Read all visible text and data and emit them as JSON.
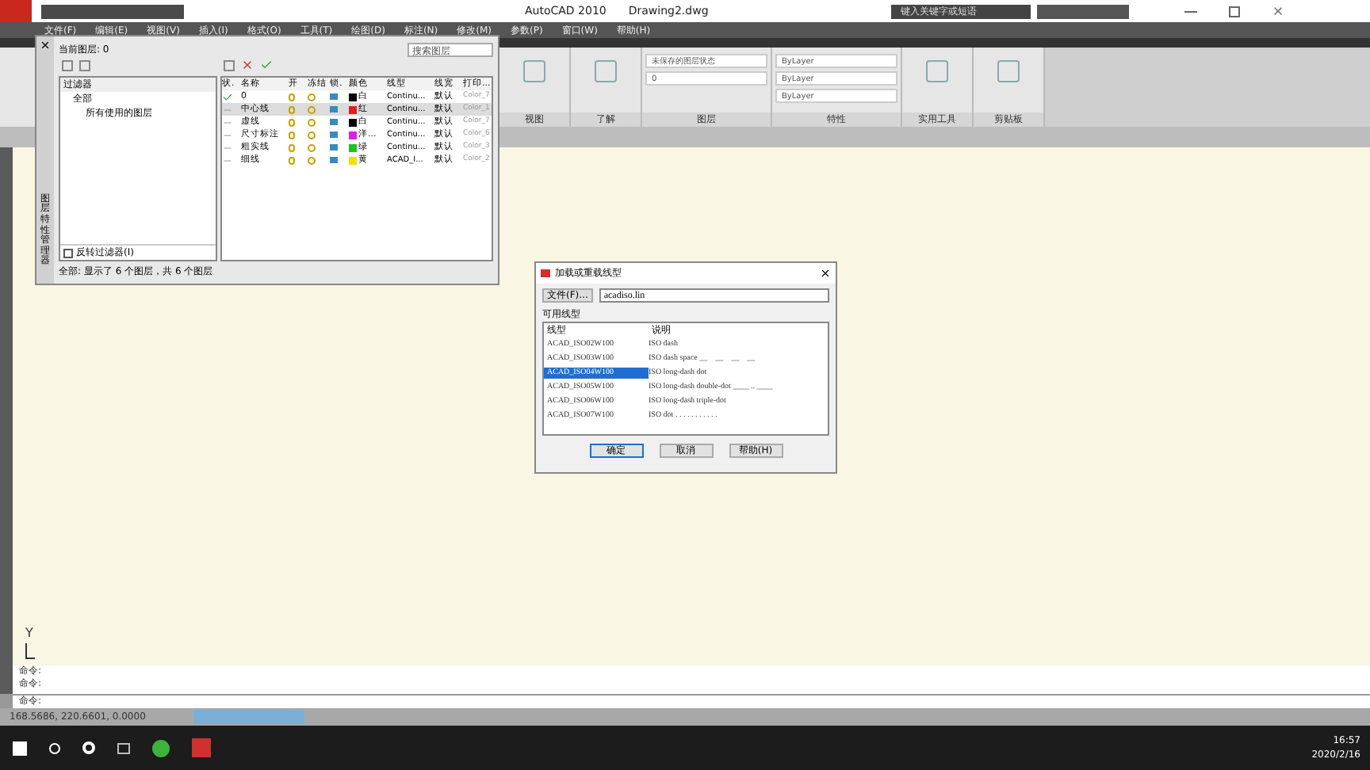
{
  "window": {
    "title": "AutoCAD 2010",
    "document": "Drawing2.dwg"
  },
  "search": {
    "placeholder": "键入关键字或短语"
  },
  "menu": [
    "文件(F)",
    "编辑(E)",
    "视图(V)",
    "插入(I)",
    "格式(O)",
    "工具(T)",
    "绘图(D)",
    "标注(N)",
    "修改(M)",
    "参数(P)",
    "窗口(W)",
    "帮助(H)"
  ],
  "ribbon": {
    "panels": [
      {
        "title": "视图"
      },
      {
        "title": "了解"
      },
      {
        "title": "图层",
        "dropdowns": [
          "未保存的图层状态",
          "0"
        ]
      },
      {
        "title": "特性",
        "dropdowns": [
          "ByLayer",
          "ByLayer",
          "ByLayer"
        ]
      },
      {
        "title": "实用工具"
      },
      {
        "title": "剪贴板"
      }
    ]
  },
  "layer_manager": {
    "current_layer": "当前图层: 0",
    "search": {
      "placeholder": "搜索图层"
    },
    "filters": {
      "title": "过滤器",
      "tree": [
        {
          "label": "全部",
          "children": [
            {
              "label": "所有使用的图层"
            }
          ]
        }
      ],
      "invert": {
        "label": "反转过滤器(I)",
        "checked": false
      }
    },
    "columns": [
      "状.",
      "名称",
      "开",
      "冻结",
      "锁.",
      "颜色",
      "线型",
      "线宽",
      "打印..."
    ],
    "layers": [
      {
        "current": true,
        "selected": false,
        "name": "0",
        "color": "#000000",
        "color_name": "白",
        "linetype": "Continu...",
        "lineweight": "默认",
        "plot_style": "Color_7"
      },
      {
        "current": false,
        "selected": true,
        "name": "中心线",
        "color": "#e02020",
        "color_name": "红",
        "linetype": "Continu...",
        "lineweight": "默认",
        "plot_style": "Color_1"
      },
      {
        "current": false,
        "selected": false,
        "name": "虚线",
        "color": "#000000",
        "color_name": "白",
        "linetype": "Continu...",
        "lineweight": "默认",
        "plot_style": "Color_7"
      },
      {
        "current": false,
        "selected": false,
        "name": "尺寸标注",
        "color": "#e020e0",
        "color_name": "洋...",
        "linetype": "Continu...",
        "lineweight": "默认",
        "plot_style": "Color_6"
      },
      {
        "current": false,
        "selected": false,
        "name": "粗实线",
        "color": "#20c020",
        "color_name": "绿",
        "linetype": "Continu...",
        "lineweight": "默认",
        "plot_style": "Color_3"
      },
      {
        "current": false,
        "selected": false,
        "name": "细线",
        "color": "#f0e000",
        "color_name": "黄",
        "linetype": "ACAD_I...",
        "lineweight": "默认",
        "plot_style": "Color_2"
      }
    ],
    "status": "全部: 显示了 6 个图层，共 6 个图层",
    "side_label": "图层特性管理器"
  },
  "dialog": {
    "title": "加载或重载线型",
    "file_button": "文件(F)...",
    "file": "acadiso.lin",
    "list_label": "可用线型",
    "columns": [
      "线型",
      "说明"
    ],
    "rows": [
      {
        "name": "ACAD_ISO02W100",
        "description": "ISO dash",
        "selected": false
      },
      {
        "name": "ACAD_ISO03W100",
        "description": "ISO dash space __    __    __    __",
        "selected": false
      },
      {
        "name": "ACAD_ISO04W100",
        "description": "ISO long-dash dot",
        "selected": true
      },
      {
        "name": "ACAD_ISO05W100",
        "description": "ISO long-dash double-dot ____ .. ____",
        "selected": false
      },
      {
        "name": "ACAD_ISO06W100",
        "description": "ISO long-dash triple-dot",
        "selected": false
      },
      {
        "name": "ACAD_ISO07W100",
        "description": "ISO dot . . . . . . . . . . .",
        "selected": false
      }
    ],
    "buttons": [
      "确定",
      "取消",
      "帮助(H)"
    ]
  },
  "axis_label": "Y",
  "command_lines": [
    "命令:",
    "命令:"
  ],
  "command_prompt": "命令:",
  "coordinates": "168.5686, 220.6601, 0.0000",
  "clock": {
    "time": "16:57",
    "date": "2020/2/16"
  }
}
